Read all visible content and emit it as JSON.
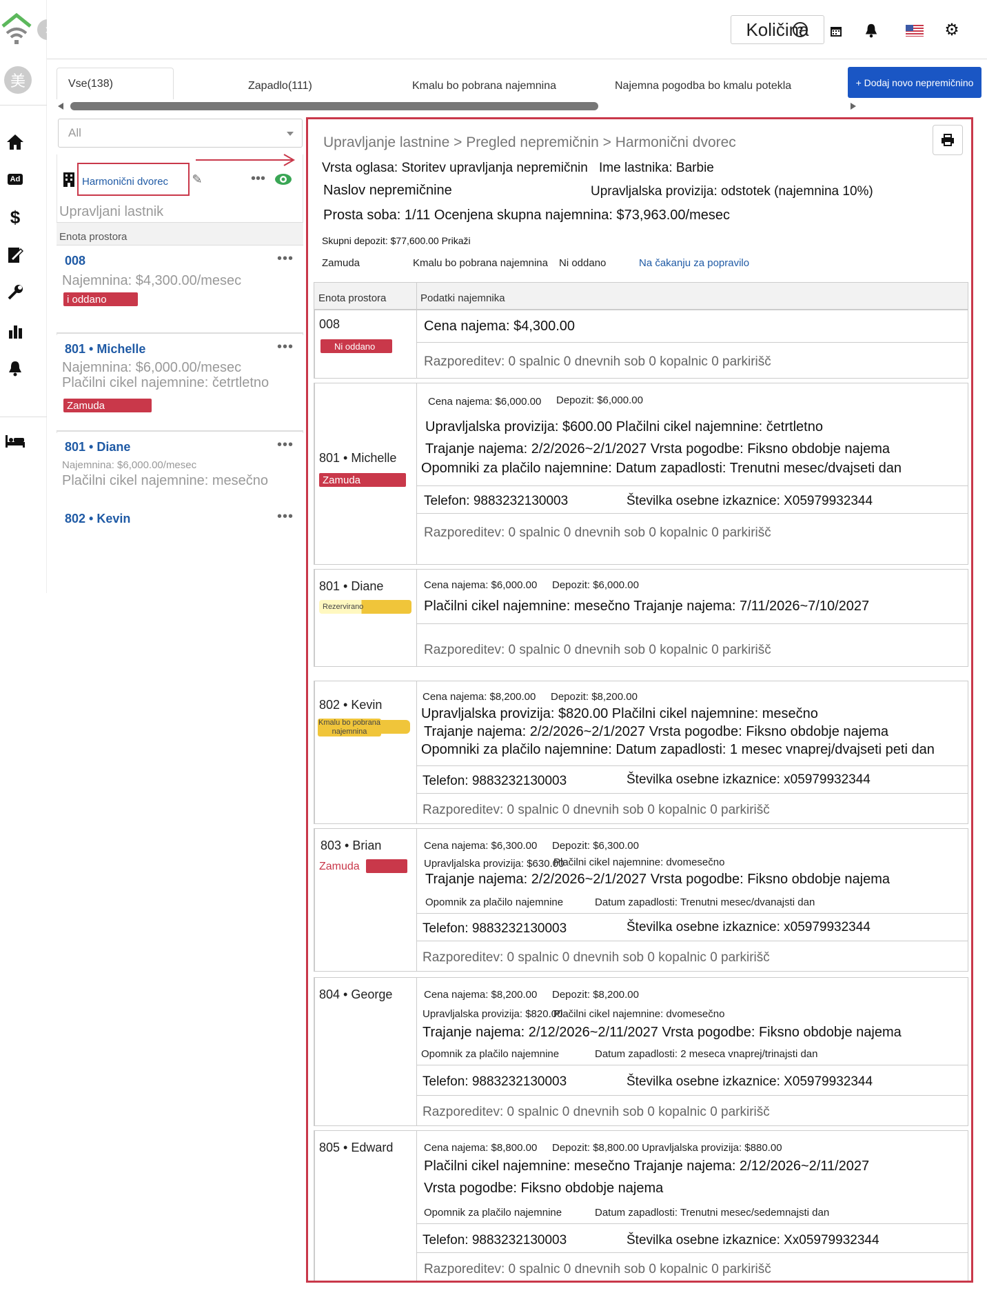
{
  "topbar": {
    "quantity_label": "Količina"
  },
  "sidebar": {
    "avatar_char": "美"
  },
  "tabs": [
    {
      "label": "Vse(138)"
    },
    {
      "label": "Zapadlo(111)"
    },
    {
      "label": "Kmalu bo pobrana najemnina"
    },
    {
      "label": "Najemna pogodba bo kmalu potekla"
    }
  ],
  "add_button": "+ Dodaj novo nepremičnino",
  "filter": {
    "value": "All"
  },
  "property": {
    "name": "Harmonični dvorec",
    "owner_label": "Upravljani lastnik",
    "unit_header": "Enota prostora"
  },
  "units": [
    {
      "title": "008",
      "line1": "Najemnina: $4,300.00/mesec",
      "badge": "i oddano"
    },
    {
      "title": "801 • Michelle",
      "line1": "Najemnina: $6,000.00/mesec",
      "line2": "Plačilni cikel najemnine: četrtletno",
      "badge": "Zamuda"
    },
    {
      "title": "801 • Diane",
      "line1": "Najemnina: $6,000.00/mesec",
      "line2": "Plačilni cikel najemnine: mesečno"
    },
    {
      "title": "802 • Kevin"
    }
  ],
  "detail": {
    "breadcrumb": "Upravljanje lastnine > Pregled nepremičnin > Harmonični dvorec",
    "ad_type": "Vrsta oglasa: Storitev upravljanja nepremičnin",
    "owner": "Ime lastnika: Barbie",
    "address_label": "Naslov nepremičnine",
    "commission": "Upravljalska provizija: odstotek (najemnina 10%)",
    "vacancy": "Prosta soba: 1/11 Ocenjena skupna najemnina: $73,963.00/mesec",
    "deposit": "Skupni depozit: $77,600.00 Prikaži",
    "statuses": [
      "Zamuda",
      "Kmalu bo pobrana najemnina",
      "Ni oddano",
      "Na čakanju za popravilo"
    ],
    "col_unit": "Enota prostora",
    "col_tenant": "Podatki najemnika"
  },
  "rows": [
    {
      "unit": "008",
      "badge": "Ni oddano",
      "price": "Cena najema: $4,300.00",
      "layout": "Razporeditev: 0 spalnic 0 dnevnih sob 0 kopalnic 0 parkirišč"
    },
    {
      "unit": "801 • Michelle",
      "badge": "Zamuda",
      "price": "Cena najema: $6,000.00",
      "deposit": "Depozit: $6,000.00",
      "l1": "Upravljalska provizija: $600.00 Plačilni cikel najemnine: četrtletno",
      "l2": "Trajanje najema: 2/2/2026~2/1/2027 Vrsta pogodbe: Fiksno obdobje najema",
      "l3": "Opomniki za plačilo najemnine: Datum zapadlosti: Trenutni mesec/dvajseti dan",
      "phone": "Telefon: 9883232130003",
      "id": "Številka osebne izkaznice: X05979932344",
      "layout": "Razporeditev: 0 spalnic 0 dnevnih sob 0 kopalnic 0 parkirišč"
    },
    {
      "unit": "801 • Diane",
      "badge": "Rezervirano",
      "price": "Cena najema: $6,000.00",
      "deposit": "Depozit: $6,000.00",
      "l1": "Plačilni cikel najemnine: mesečno Trajanje najema: 7/11/2026~7/10/2027",
      "layout": "Razporeditev: 0 spalnic 0 dnevnih sob 0 kopalnic 0 parkirišč"
    },
    {
      "unit": "802 • Kevin",
      "badge": "Kmalu bo pobrana najemnina",
      "price": "Cena najema: $8,200.00",
      "deposit": "Depozit: $8,200.00",
      "l1": "Upravljalska provizija: $820.00 Plačilni cikel najemnine: mesečno",
      "l2": "Trajanje najema: 2/2/2026~2/1/2027 Vrsta pogodbe: Fiksno obdobje najema",
      "l3": "Opomniki za plačilo najemnine: Datum zapadlosti: 1 mesec vnaprej/dvajseti peti dan",
      "phone": "Telefon: 9883232130003",
      "id": "Številka osebne izkaznice: x05979932344",
      "layout": "Razporeditev: 0 spalnic 0 dnevnih sob 0 kopalnic 0 parkirišč"
    },
    {
      "unit": "803 • Brian",
      "badge": "Zamuda",
      "price": "Cena najema: $6,300.00",
      "deposit": "Depozit: $6,300.00",
      "commission": "Upravljalska provizija: $630.00",
      "cycle": "Plačilni cikel najemnine: dvomesečno",
      "l2": "Trajanje najema: 2/2/2026~2/1/2027 Vrsta pogodbe: Fiksno obdobje najema",
      "reminder": "Opomnik za plačilo najemnine",
      "due": "Datum zapadlosti: Trenutni mesec/dvanajsti dan",
      "phone": "Telefon: 9883232130003",
      "id": "Številka osebne izkaznice: x05979932344",
      "layout": "Razporeditev: 0 spalnic 0 dnevnih sob 0 kopalnic 0 parkirišč"
    },
    {
      "unit": "804 • George",
      "price": "Cena najema: $8,200.00",
      "deposit": "Depozit: $8,200.00",
      "commission": "Upravljalska provizija: $820.00",
      "cycle": "Plačilni cikel najemnine: dvomesečno",
      "l2": "Trajanje najema: 2/12/2026~2/11/2027 Vrsta pogodbe: Fiksno obdobje najema",
      "reminder": "Opomnik za plačilo najemnine",
      "due": "Datum zapadlosti: 2 meseca vnaprej/trinajsti dan",
      "phone": "Telefon: 9883232130003",
      "id": "Številka osebne izkaznice: X05979932344",
      "layout": "Razporeditev: 0 spalnic 0 dnevnih sob 0 kopalnic 0 parkirišč"
    },
    {
      "unit": "805 • Edward",
      "price": "Cena najema: $8,800.00",
      "deposit": "Depozit: $8,800.00 Upravljalska provizija: $880.00",
      "l1": "Plačilni cikel najemnine: mesečno Trajanje najema: 2/12/2026~2/11/2027",
      "l2": "Vrsta pogodbe: Fiksno obdobje najema",
      "reminder": "Opomnik za plačilo najemnine",
      "due": "Datum zapadlosti: Trenutni mesec/sedemnajsti dan",
      "phone": "Telefon: 9883232130003",
      "id": "Številka osebne izkaznice: Xx05979932344",
      "layout": "Razporeditev: 0 spalnic 0 dnevnih sob 0 kopalnic 0 parkirišč"
    }
  ]
}
